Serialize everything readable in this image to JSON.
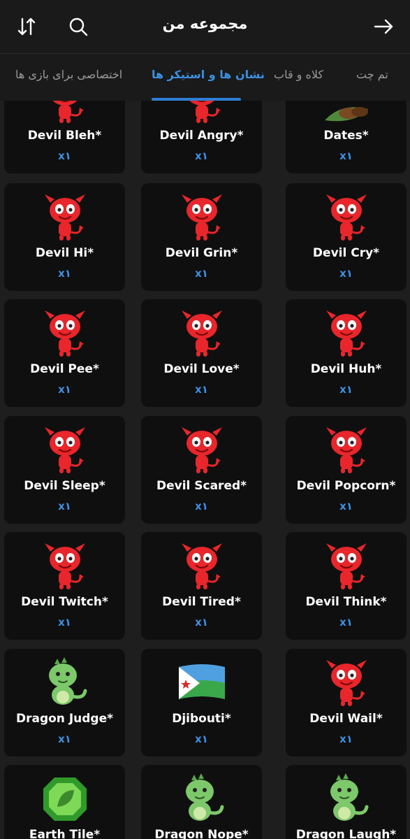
{
  "header": {
    "title": "مجموعه من",
    "sort_icon": "sort-arrows-icon",
    "search_icon": "search-icon",
    "back_icon": "arrow-right-icon"
  },
  "tabs": [
    {
      "label": "تم چت",
      "active": false
    },
    {
      "label": "کلاه و قاب",
      "active": false
    },
    {
      "label": "نشان ها و استیکر ها",
      "active": true
    },
    {
      "label": "اختصاصی برای بازی ها",
      "active": false
    }
  ],
  "colors": {
    "accent": "#3d8fe0",
    "card": "#0f0f0f",
    "bg": "#1e1e1e",
    "devil_red": "#e8262b",
    "dragon_green": "#7cc86a"
  },
  "items": [
    {
      "name": "Devil Bleh*",
      "count": "x۱",
      "icon": "devil-bleh-icon",
      "kind": "devil"
    },
    {
      "name": "Devil Angry*",
      "count": "x۱",
      "icon": "devil-angry-icon",
      "kind": "devil"
    },
    {
      "name": "Dates*",
      "count": "x۱",
      "icon": "dates-icon",
      "kind": "dates"
    },
    {
      "name": "Devil Hi*",
      "count": "x۱",
      "icon": "devil-hi-icon",
      "kind": "devil"
    },
    {
      "name": "Devil Grin*",
      "count": "x۱",
      "icon": "devil-grin-icon",
      "kind": "devil"
    },
    {
      "name": "Devil Cry*",
      "count": "x۱",
      "icon": "devil-cry-icon",
      "kind": "devil"
    },
    {
      "name": "Devil Pee*",
      "count": "x۱",
      "icon": "devil-pee-icon",
      "kind": "devil"
    },
    {
      "name": "Devil Love*",
      "count": "x۱",
      "icon": "devil-love-icon",
      "kind": "devil"
    },
    {
      "name": "Devil Huh*",
      "count": "x۱",
      "icon": "devil-huh-icon",
      "kind": "devil"
    },
    {
      "name": "Devil Sleep*",
      "count": "x۱",
      "icon": "devil-sleep-icon",
      "kind": "devil"
    },
    {
      "name": "Devil Scared*",
      "count": "x۱",
      "icon": "devil-scared-icon",
      "kind": "devil"
    },
    {
      "name": "Devil Popcorn*",
      "count": "x۱",
      "icon": "devil-popcorn-icon",
      "kind": "devil"
    },
    {
      "name": "Devil Twitch*",
      "count": "x۱",
      "icon": "devil-twitch-icon",
      "kind": "devil"
    },
    {
      "name": "Devil Tired*",
      "count": "x۱",
      "icon": "devil-tired-icon",
      "kind": "devil"
    },
    {
      "name": "Devil Think*",
      "count": "x۱",
      "icon": "devil-think-icon",
      "kind": "devil"
    },
    {
      "name": "Dragon Judge*",
      "count": "x۱",
      "icon": "dragon-judge-icon",
      "kind": "dragon"
    },
    {
      "name": "Djibouti*",
      "count": "x۱",
      "icon": "djibouti-flag-icon",
      "kind": "flag"
    },
    {
      "name": "Devil Wail*",
      "count": "x۱",
      "icon": "devil-wail-icon",
      "kind": "devil"
    },
    {
      "name": "Earth Tile*",
      "count": "",
      "icon": "earth-tile-icon",
      "kind": "gem"
    },
    {
      "name": "Dragon Nope*",
      "count": "",
      "icon": "dragon-nope-icon",
      "kind": "dragon"
    },
    {
      "name": "Dragon Laugh*",
      "count": "",
      "icon": "dragon-laugh-icon",
      "kind": "dragon"
    }
  ]
}
